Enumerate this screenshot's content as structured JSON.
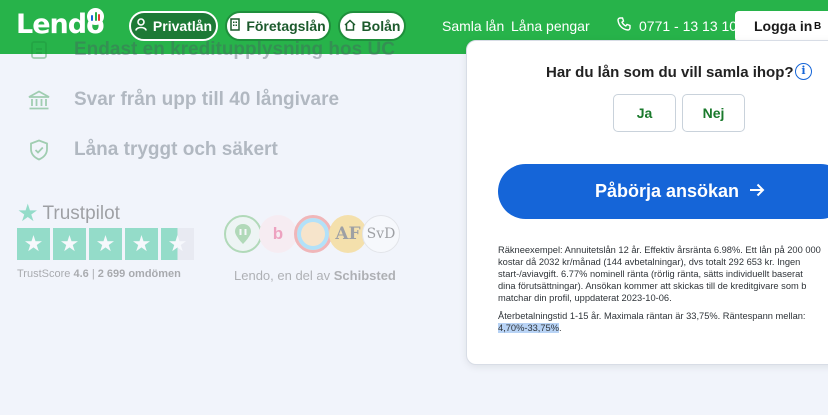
{
  "header": {
    "logo": "Lendo",
    "tabs": [
      {
        "label": "Privatlån",
        "icon": "person-icon",
        "active": true
      },
      {
        "label": "Företagslån",
        "icon": "building-icon",
        "active": false
      },
      {
        "label": "Bolån",
        "icon": "house-icon",
        "active": false
      }
    ],
    "links": [
      "Samla lån",
      "Låna pengar"
    ],
    "phone": "0771 - 13 13 10",
    "login": "Logga in",
    "login_badge": "B"
  },
  "benefits": [
    {
      "text": "Endast en kreditupplysning hos UC",
      "icon": "document-icon"
    },
    {
      "text": "Svar från upp till 40 långivare",
      "icon": "bank-icon"
    },
    {
      "text": "Låna tryggt och säkert",
      "icon": "shield-icon"
    }
  ],
  "trustpilot": {
    "brand": "Trustpilot",
    "rating": 4.5,
    "score_label": "TrustScore",
    "score": "4.6",
    "reviews": "2 699 omdömen",
    "separator": "|"
  },
  "partners": [
    "b",
    "AF",
    "SvD"
  ],
  "schibsted": {
    "prefix": "Lendo, en del av ",
    "brand": "Schibsted"
  },
  "form": {
    "question": "Har du lån som du vill samla ihop?",
    "yes": "Ja",
    "no": "Nej",
    "cta": "Påbörja ansökan"
  },
  "disclaimer": {
    "lines": [
      "Räkneexempel: Annuitetslån 12 år. Effektiv årsränta 6.98%. Ett lån på 200 000",
      "kostar då 2032 kr/månad (144 avbetalningar), dvs totalt 292 653 kr. Ingen",
      "start-/aviavgift. 6.77% nominell ränta (rörlig ränta, sätts individuellt baserat",
      "dina förutsättningar). Ansökan kommer att skickas till de kreditgivare som b",
      "matchar din profil, uppdaterat 2023-10-06."
    ],
    "terms": "Återbetalningstid 1-15 år. Maximala räntan är 33,75%. Räntespann mellan:",
    "range": "4,70%-33,75%",
    "range_suffix": "."
  },
  "colors": {
    "brand_green": "#27b34a",
    "cta_blue": "#1565d8",
    "trustpilot_green": "#00b67a"
  }
}
